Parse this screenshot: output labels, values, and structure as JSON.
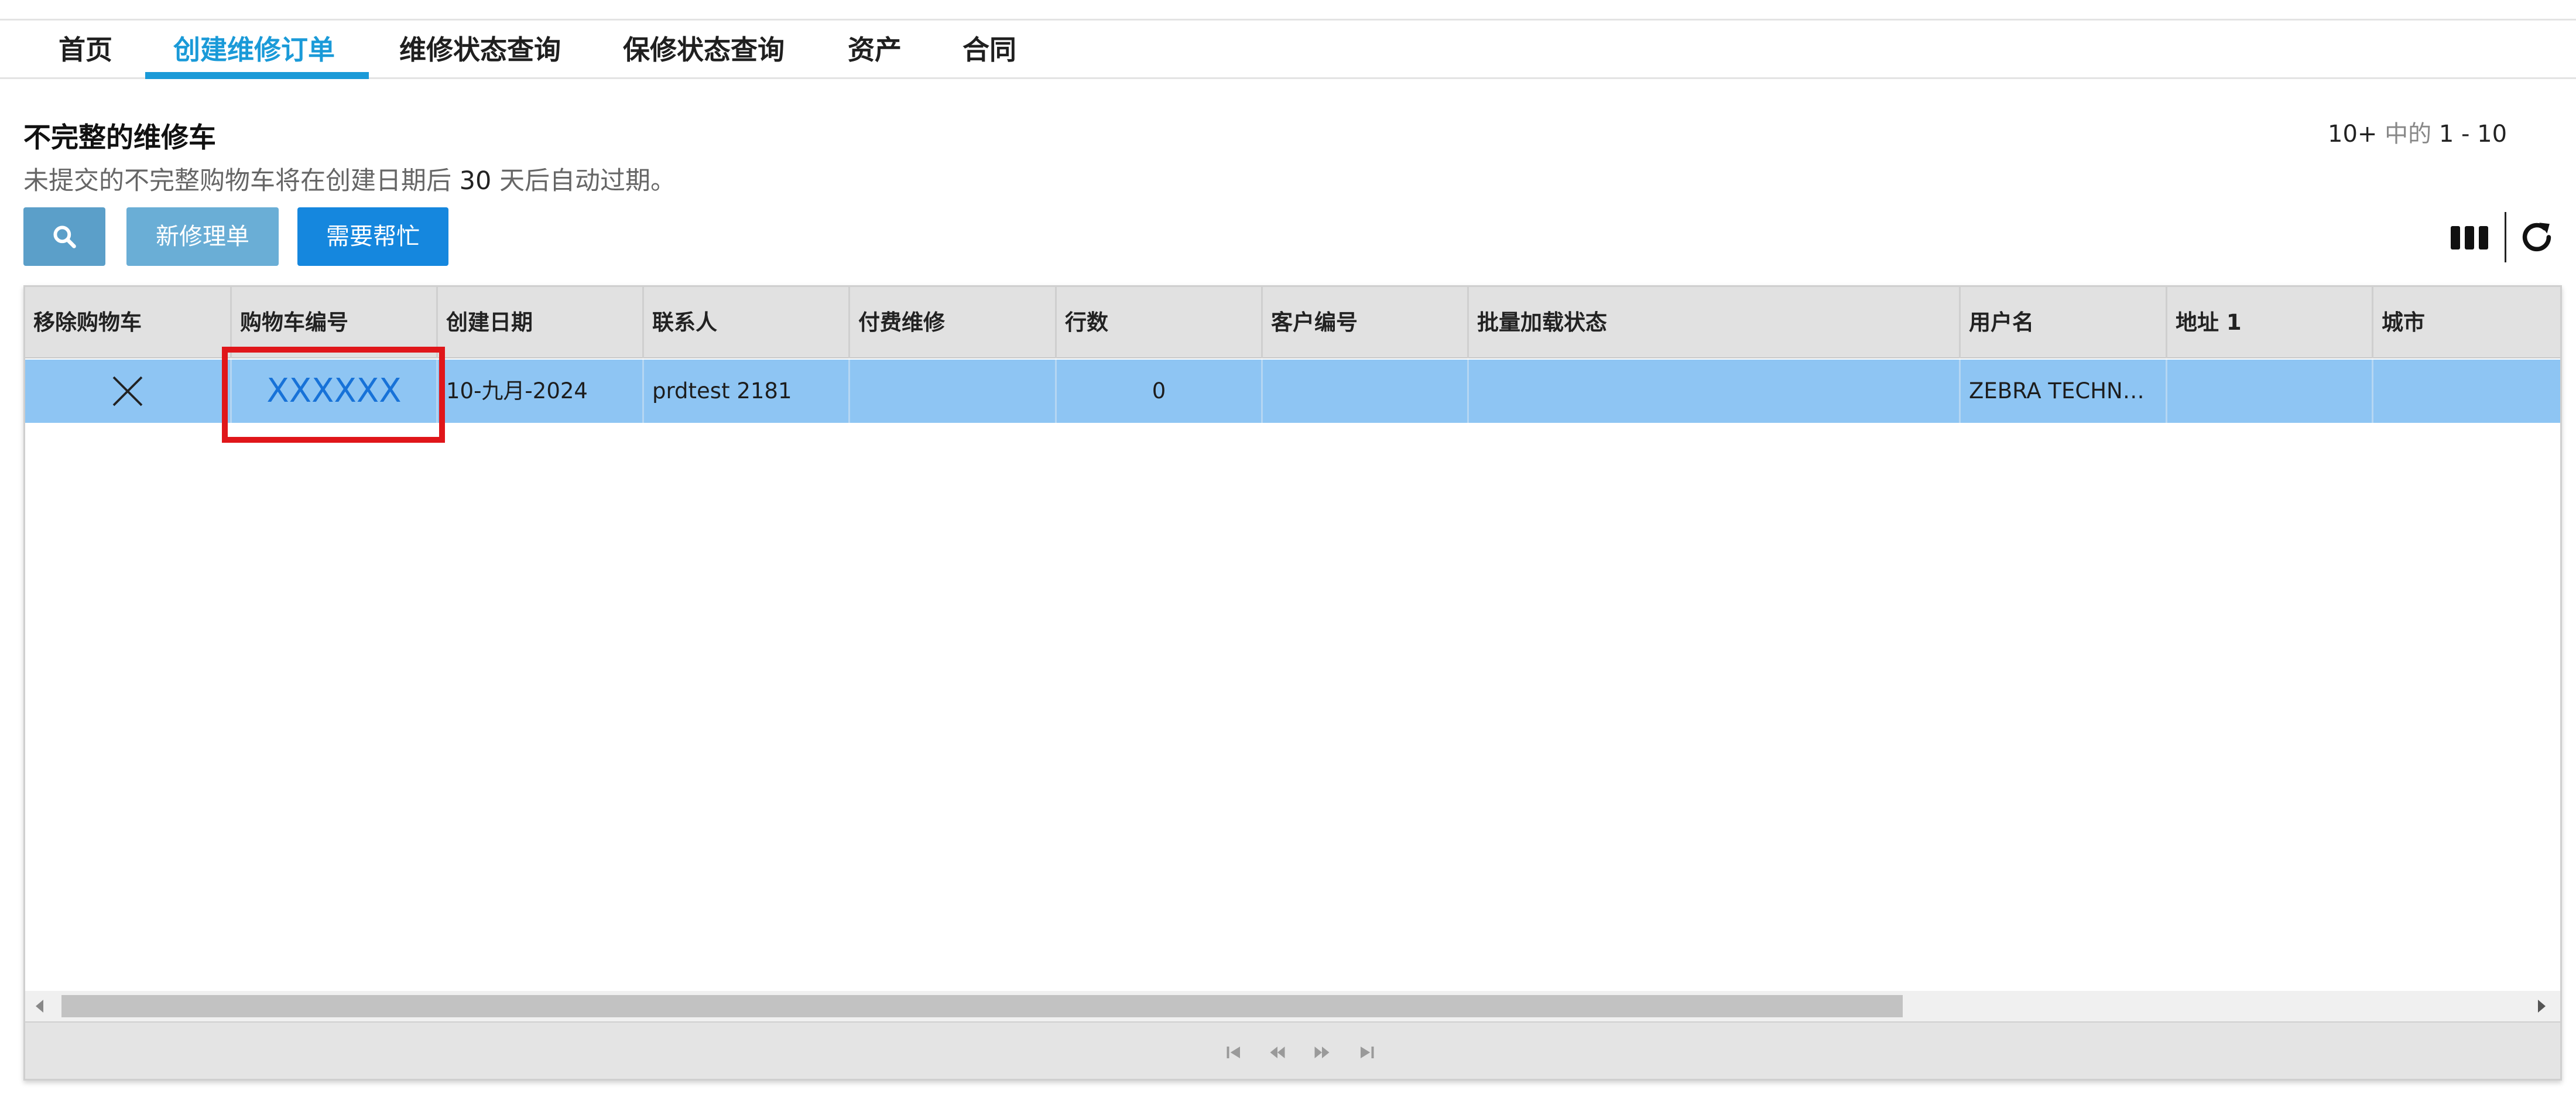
{
  "nav": {
    "tabs": [
      {
        "label": "首页",
        "active": false
      },
      {
        "label": "创建维修订单",
        "active": true
      },
      {
        "label": "维修状态查询",
        "active": false
      },
      {
        "label": "保修状态查询",
        "active": false
      },
      {
        "label": "资产",
        "active": false
      },
      {
        "label": "合同",
        "active": false
      }
    ]
  },
  "page": {
    "title": "不完整的维修车",
    "subtitle_before": "未提交的不完整购物车将在创建日期后",
    "subtitle_days": "30",
    "subtitle_after": "天后自动过期。",
    "pager": {
      "total": "10+",
      "middle": "中的",
      "range": "1 - 10"
    }
  },
  "toolbar": {
    "search_icon": "search-icon",
    "new_label": "新修理单",
    "help_label": "需要帮忙",
    "columns_icon": "column-chooser-icon",
    "refresh_icon": "refresh-icon"
  },
  "grid": {
    "columns": [
      "移除购物车",
      "购物车编号",
      "创建日期",
      "联系人",
      "付费维修",
      "行数",
      "客户编号",
      "批量加载状态",
      "用户名",
      "地址 1",
      "城市"
    ],
    "rows": [
      {
        "remove_icon": "close-icon",
        "cart_number": "XXXXXX",
        "created_date": "10-九月-2024",
        "contact": "prdtest 2181",
        "paid_repair": "",
        "line_count": "0",
        "customer_number": "",
        "bulk_status": "",
        "username": "ZEBRA TECHNOLOGIES",
        "address1": "",
        "city": ""
      }
    ]
  },
  "colors": {
    "accent": "#1a9ad8",
    "selected_row": "#8ec5f3",
    "highlight": "#e0161a",
    "link": "#1772d8"
  }
}
